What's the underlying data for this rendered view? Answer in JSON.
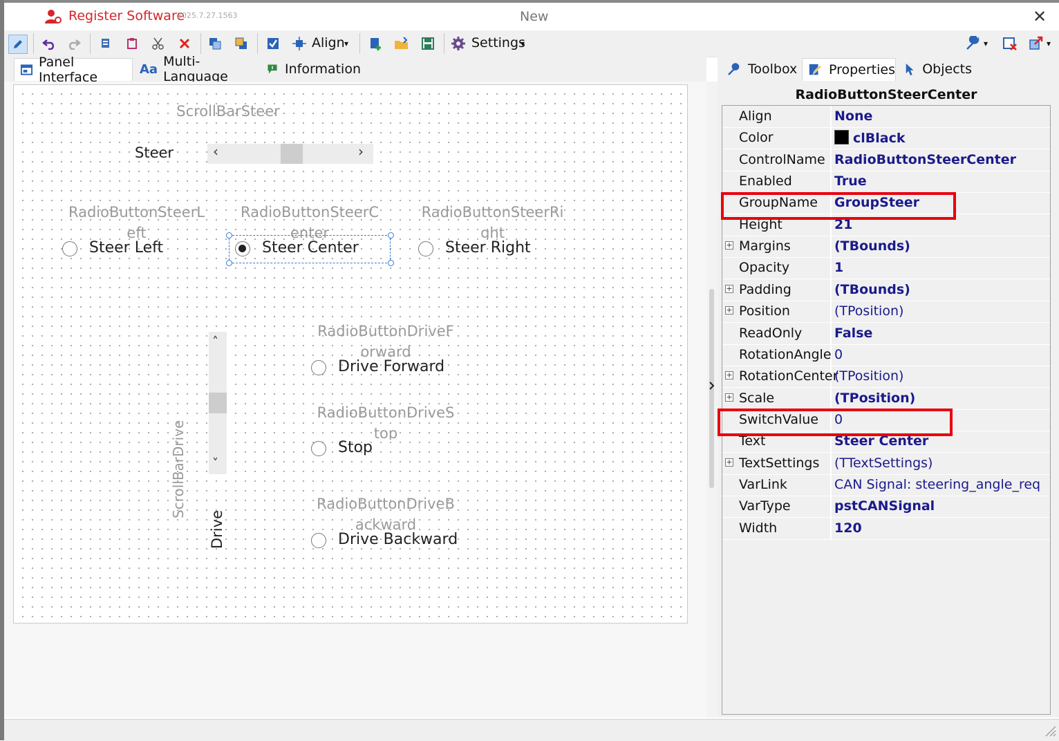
{
  "titlebar": {
    "app_name": "Register Software",
    "version": "2025.7.27.1563",
    "document": "New",
    "close": "✕"
  },
  "toolbar": {
    "align_label": "Align",
    "settings_label": "Settings",
    "dropdown_caret": "▾"
  },
  "designer_tabs": [
    {
      "label": "Panel Interface",
      "icon": "panel-icon",
      "active": true
    },
    {
      "label": "Multi-Language",
      "icon": "font-aa-icon",
      "active": false
    },
    {
      "label": "Information",
      "icon": "info-flag-icon",
      "active": false
    }
  ],
  "icons": {
    "panel": "▣",
    "font": "Aa",
    "info": "⚑",
    "wrench": "🔧",
    "properties": "✎",
    "objects": "➤",
    "expand": "+"
  },
  "canvas": {
    "scrollbar_steer": {
      "name": "ScrollBarSteer",
      "label": "Steer",
      "left_arrow": "‹",
      "right_arrow": "›"
    },
    "scrollbar_drive": {
      "name": "ScrollBarDrive",
      "label": "Drive",
      "up_arrow": "˄",
      "down_arrow": "˅"
    },
    "radios": [
      {
        "name_line1": "RadioButtonSteerL",
        "name_line2": "eft",
        "text": "Steer Left",
        "checked": false
      },
      {
        "name_line1": "RadioButtonSteerC",
        "name_line2": "enter",
        "text": "Steer Center",
        "checked": true
      },
      {
        "name_line1": "RadioButtonSteerRi",
        "name_line2": "ght",
        "text": "Steer Right",
        "checked": false
      },
      {
        "name_line1": "RadioButtonDriveF",
        "name_line2": "orward",
        "text": "Drive Forward",
        "checked": false
      },
      {
        "name_line1": "RadioButtonDriveS",
        "name_line2": "top",
        "text": "Stop",
        "checked": false
      },
      {
        "name_line1": "RadioButtonDriveB",
        "name_line2": "ackward",
        "text": "Drive Backward",
        "checked": false
      }
    ]
  },
  "right_tabs": [
    {
      "label": "Toolbox",
      "icon": "wrench-icon",
      "active": false
    },
    {
      "label": "Properties",
      "icon": "properties-icon",
      "active": true
    },
    {
      "label": "Objects",
      "icon": "pointer-icon",
      "active": false
    }
  ],
  "properties": {
    "object_name": "RadioButtonSteerCenter",
    "rows": [
      {
        "name": "Align",
        "value": "None",
        "bold": true,
        "expandable": false
      },
      {
        "name": "Color",
        "value": "clBlack",
        "bold": true,
        "expandable": false,
        "swatch": "#000000"
      },
      {
        "name": "ControlName",
        "value": "RadioButtonSteerCenter",
        "bold": true,
        "expandable": false
      },
      {
        "name": "Enabled",
        "value": "True",
        "bold": true,
        "expandable": false
      },
      {
        "name": "GroupName",
        "value": "GroupSteer",
        "bold": true,
        "expandable": false,
        "highlighted": true
      },
      {
        "name": "Height",
        "value": "21",
        "bold": true,
        "expandable": false
      },
      {
        "name": "Margins",
        "value": "(TBounds)",
        "bold": true,
        "expandable": true
      },
      {
        "name": "Opacity",
        "value": "1",
        "bold": true,
        "expandable": false
      },
      {
        "name": "Padding",
        "value": "(TBounds)",
        "bold": true,
        "expandable": true
      },
      {
        "name": "Position",
        "value": "(TPosition)",
        "bold": false,
        "expandable": true
      },
      {
        "name": "ReadOnly",
        "value": "False",
        "bold": true,
        "expandable": false
      },
      {
        "name": "RotationAngle",
        "value": "0",
        "bold": false,
        "expandable": false
      },
      {
        "name": "RotationCenter",
        "value": "(TPosition)",
        "bold": false,
        "expandable": true
      },
      {
        "name": "Scale",
        "value": "(TPosition)",
        "bold": true,
        "expandable": true
      },
      {
        "name": "SwitchValue",
        "value": "0",
        "bold": false,
        "expandable": false,
        "highlighted": true
      },
      {
        "name": "Text",
        "value": "Steer Center",
        "bold": true,
        "expandable": false
      },
      {
        "name": "TextSettings",
        "value": "(TTextSettings)",
        "bold": false,
        "expandable": true
      },
      {
        "name": "VarLink",
        "value": "CAN Signal: steering_angle_req",
        "bold": false,
        "expandable": false
      },
      {
        "name": "VarType",
        "value": "pstCANSignal",
        "bold": true,
        "expandable": false
      },
      {
        "name": "Width",
        "value": "120",
        "bold": true,
        "expandable": false
      }
    ]
  },
  "colors": {
    "accent_red": "#e8000e",
    "title_red": "#d6262b",
    "value_blue": "#1a1a8c",
    "selection_blue": "#2f7fd3"
  }
}
